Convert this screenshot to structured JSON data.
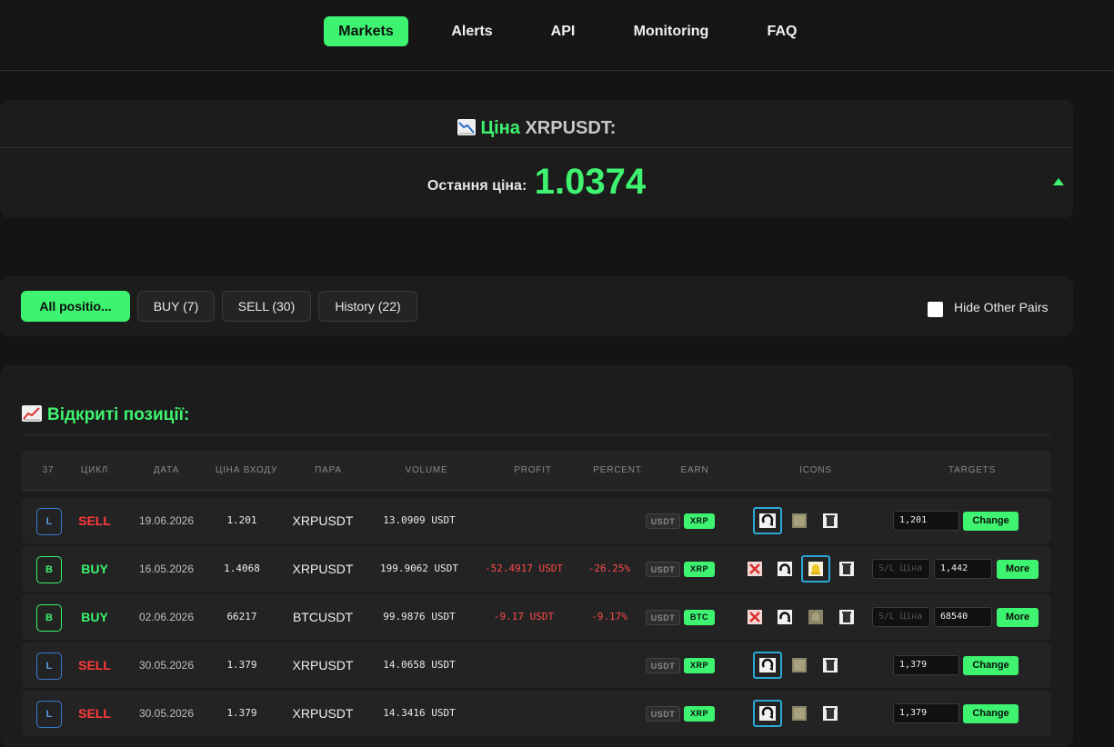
{
  "nav": {
    "items": [
      "Markets",
      "Alerts",
      "API",
      "Monitoring",
      "FAQ"
    ],
    "active": "Markets"
  },
  "price": {
    "title_prefix": "Ціна",
    "symbol": "XRPUSDT:",
    "label": "Остання ціна:",
    "value": "1.0374",
    "trend": "up"
  },
  "filters": {
    "buttons": [
      "All positio...",
      "BUY (7)",
      "SELL (30)",
      "History (22)"
    ],
    "active": "All positio...",
    "hide_other_pairs": {
      "label": "Hide Other Pairs",
      "checked": false
    }
  },
  "positions": {
    "title": "Відкриті позиції:",
    "headers": [
      "37",
      "ЦИКЛ",
      "ДАТА",
      "ЦІНА ВХОДУ",
      "ПАРА",
      "VOLUME",
      "PROFIT",
      "PERCENT",
      "EARN",
      "ICONS",
      "TARGETS"
    ],
    "rows": [
      {
        "badge": "L",
        "cycle": "SELL",
        "date": "19.06.2026",
        "entry": "1.201",
        "pair": "XRPUSDT",
        "volume": "13.0909 USDT",
        "profit": "",
        "percent": "",
        "earn_base": "USDT",
        "earn_coin": "XRP",
        "sl_placeholder": "",
        "target": "1,201",
        "action": "Change"
      },
      {
        "badge": "B",
        "cycle": "BUY",
        "date": "16.05.2026",
        "entry": "1.4068",
        "pair": "XRPUSDT",
        "volume": "199.9062 USDT",
        "profit": "-52.4917 USDT",
        "percent": "-26.25%",
        "earn_base": "USDT",
        "earn_coin": "XRP",
        "sl_placeholder": "S/L Ціна",
        "target": "1,442",
        "action": "More"
      },
      {
        "badge": "B",
        "cycle": "BUY",
        "date": "02.06.2026",
        "entry": "66217",
        "pair": "BTCUSDT",
        "volume": "99.9876 USDT",
        "profit": "-9.17 USDT",
        "percent": "-9.17%",
        "earn_base": "USDT",
        "earn_coin": "BTC",
        "sl_placeholder": "S/L Ціна",
        "target": "68540",
        "action": "More"
      },
      {
        "badge": "L",
        "cycle": "SELL",
        "date": "30.05.2026",
        "entry": "1.379",
        "pair": "XRPUSDT",
        "volume": "14.0658 USDT",
        "profit": "",
        "percent": "",
        "earn_base": "USDT",
        "earn_coin": "XRP",
        "sl_placeholder": "",
        "target": "1,379",
        "action": "Change"
      },
      {
        "badge": "L",
        "cycle": "SELL",
        "date": "30.05.2026",
        "entry": "1.379",
        "pair": "XRPUSDT",
        "volume": "14.3416 USDT",
        "profit": "",
        "percent": "",
        "earn_base": "USDT",
        "earn_coin": "XRP",
        "sl_placeholder": "",
        "target": "1,379",
        "action": "Change"
      }
    ]
  },
  "colors": {
    "accent": "#3df36f",
    "negative": "#ff3b3b",
    "background": "#141414",
    "card": "#1c1c1c",
    "info_border": "#2aa8d8"
  },
  "icons": [
    "chart-down-icon",
    "chart-up-icon",
    "close-icon",
    "refresh-icon",
    "box-icon",
    "bell-icon",
    "trash-icon",
    "triangle-up-icon"
  ]
}
